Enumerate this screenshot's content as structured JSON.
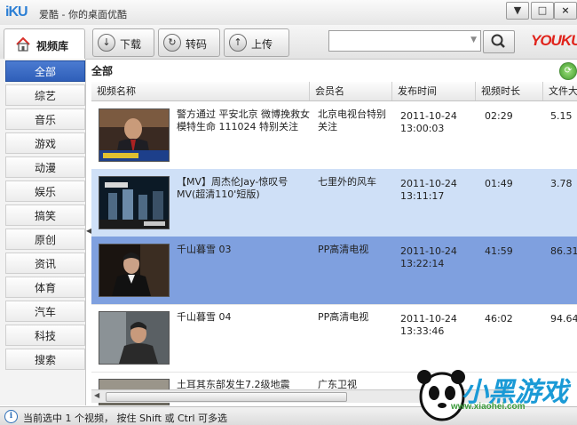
{
  "window": {
    "logo_text": "iKU",
    "title": "爱酷 - 你的桌面优酷",
    "minimize_glyph": "▼",
    "restore_glyph": "□",
    "close_glyph": "×"
  },
  "toolbar": {
    "library_tab": "视频库",
    "download_label": "下载",
    "transcode_label": "转码",
    "upload_label": "上传",
    "search_placeholder": "",
    "brand": "YOUKU"
  },
  "sidebar": {
    "categories": [
      "全部",
      "综艺",
      "音乐",
      "游戏",
      "动漫",
      "娱乐",
      "搞笑",
      "原创",
      "资讯",
      "体育",
      "汽车",
      "科技",
      "搜索"
    ],
    "active_index": 0
  },
  "main": {
    "section_title": "全部",
    "columns": [
      "视频名称",
      "会员名",
      "发布时间",
      "视频时长",
      "文件大小"
    ],
    "rows": [
      {
        "title": "警方通过 平安北京 微博挽救女模特生命 111024 特别关注",
        "uploader": "北京电视台特别关注",
        "date": "2011-10-24",
        "time": "13:00:03",
        "duration": "02:29",
        "size": "5.15"
      },
      {
        "title": "【MV】周杰伦Jay-惊叹号MV(超清110'短版)",
        "uploader": "七里外的风车",
        "date": "2011-10-24",
        "time": "13:11:17",
        "duration": "01:49",
        "size": "3.78"
      },
      {
        "title": "千山暮雪 03",
        "uploader": "PP高清电视",
        "date": "2011-10-24",
        "time": "13:22:14",
        "duration": "41:59",
        "size": "86.31"
      },
      {
        "title": "千山暮雪 04",
        "uploader": "PP高清电视",
        "date": "2011-10-24",
        "time": "13:33:46",
        "duration": "46:02",
        "size": "94.64"
      },
      {
        "title": "土耳其东部发生7.2级地震",
        "uploader": "广东卫视",
        "date": "",
        "time": "",
        "duration": "",
        "size": ""
      }
    ]
  },
  "status": {
    "text": "当前选中 1 个视频， 按住 Shift 或 Ctrl 可多选"
  },
  "watermark": {
    "text": "小黑游戏",
    "site": "www.xiaohei.com"
  },
  "colors": {
    "selected_row": "#7fa0df",
    "hover_row": "#cfe0f7",
    "accent": "#2f5fb9"
  }
}
